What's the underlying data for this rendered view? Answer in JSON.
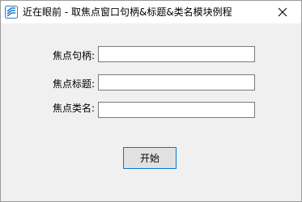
{
  "window": {
    "title": "近在眼前 - 取焦点窗口句柄&标题&类名模块例程",
    "icon": "app-logo-icon",
    "close_icon": "close-icon"
  },
  "form": {
    "fields": [
      {
        "label": "焦点句柄:",
        "value": ""
      },
      {
        "label": "焦点标题:",
        "value": ""
      },
      {
        "label": "焦点类名:",
        "value": ""
      }
    ],
    "start_button": "开始"
  },
  "colors": {
    "accent": "#0078d7",
    "window_bg": "#f0f0f0",
    "icon_blue": "#2a79c5"
  }
}
